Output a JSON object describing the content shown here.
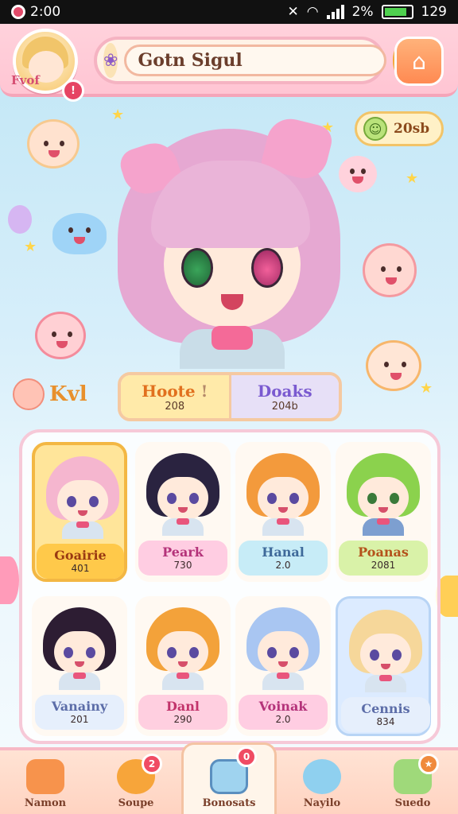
{
  "status": {
    "left_text": "2:00",
    "right_text": "2%",
    "time": "129"
  },
  "header": {
    "avatar_tag": "Fvof",
    "level_badge": "!",
    "search": {
      "value": "Gotn Sigul",
      "placeholder": "Gotn Sigul"
    }
  },
  "currency": {
    "value": "20sb"
  },
  "hero_side_label": "Kvl",
  "tabs": [
    {
      "label": "Hoote",
      "sub": "208",
      "marker": "!"
    },
    {
      "label": "Doaks",
      "sub": "204b"
    }
  ],
  "characters": [
    {
      "name": "Goairie",
      "num": "401",
      "hair": "#f5b6cf",
      "selected": true
    },
    {
      "name": "Peark",
      "num": "730",
      "hair": "#2a2340"
    },
    {
      "name": "Hanal",
      "num": "2.0",
      "hair": "#f39a3c"
    },
    {
      "name": "Poanas",
      "num": "2081",
      "hair": "#8bd24d"
    },
    {
      "name": "Vanainy",
      "num": "201",
      "hair": "#2d1d33"
    },
    {
      "name": "Danl",
      "num": "290",
      "hair": "#f3a23a"
    },
    {
      "name": "Voinak",
      "num": "2.0",
      "hair": "#a9c6f2"
    },
    {
      "name": "Cennis",
      "num": "834",
      "hair": "#f6d79a"
    }
  ],
  "nav": [
    {
      "label": "Namon",
      "badge": ""
    },
    {
      "label": "Soupe",
      "badge": "2"
    },
    {
      "label": "Bonosats",
      "badge": "0"
    },
    {
      "label": "Nayilo",
      "badge": ""
    },
    {
      "label": "Suedo",
      "badge": "★"
    }
  ],
  "colors": {
    "accent_pink": "#f5a5b9",
    "gold": "#ffc94a",
    "header_bg": "#ffc5d3"
  }
}
